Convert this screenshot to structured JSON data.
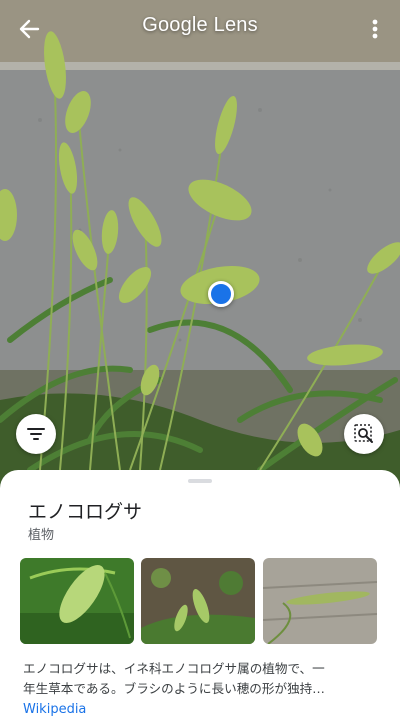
{
  "header": {
    "title": "Google Lens",
    "back_icon": "arrow-back-icon",
    "more_icon": "more-vert-icon"
  },
  "viewfinder": {
    "subject": "green foxtail grass against a concrete wall",
    "focus_dot_color": "#1a73e8"
  },
  "actions": {
    "filter_icon": "filter-list-icon",
    "search_region_icon": "search-region-icon"
  },
  "result": {
    "title": "エノコログサ",
    "subtitle": "植物",
    "thumbnails": [
      {
        "name": "foxtail-close-up"
      },
      {
        "name": "foxtail-in-garden"
      },
      {
        "name": "foxtail-on-pavement"
      }
    ],
    "description_lines": [
      "エノコログサは、イネ科エノコログサ属の植物で、一",
      "年生草本である。ブラシのように長い穂の形が独持…"
    ],
    "source": "Wikipedia"
  },
  "colors": {
    "accent": "#1a73e8",
    "sheet_bg": "#ffffff",
    "title_text": "#202124",
    "secondary_text": "#5f6368"
  }
}
